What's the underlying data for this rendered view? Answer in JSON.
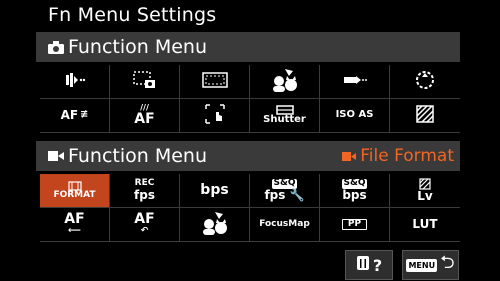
{
  "screen": {
    "title": "Fn Menu Settings"
  },
  "photo_section": {
    "label": "Function Menu",
    "icon": "camera-icon"
  },
  "movie_section": {
    "label": "Function Menu",
    "icon": "movie-icon",
    "current_item_label": "File Format"
  },
  "photo_items": [
    {
      "name": "drive-mode",
      "icon": "drive-mode-icon"
    },
    {
      "name": "focus-area-camera",
      "icon": "focus-area-camera-icon"
    },
    {
      "name": "aspect-frame",
      "icon": "frame-icon"
    },
    {
      "name": "face-eye-af",
      "icon": "face-animal-icon"
    },
    {
      "name": "af-tracking",
      "icon": "af-tracking-icon"
    },
    {
      "name": "dial-focus",
      "icon": "focus-ring-icon"
    },
    {
      "name": "af-sensitivity",
      "text": "AF"
    },
    {
      "name": "af-illuminator",
      "text": "AF"
    },
    {
      "name": "touch-focus",
      "icon": "touch-focus-icon"
    },
    {
      "name": "shutter-type",
      "text": "Shutter"
    },
    {
      "name": "iso-auto",
      "text": "ISO AS"
    },
    {
      "name": "zebra",
      "icon": "zebra-icon"
    }
  ],
  "movie_items": [
    {
      "name": "file-format",
      "text": "FORMAT",
      "selected": true
    },
    {
      "name": "rec-frame-rate",
      "line1": "REC",
      "line2": "fps"
    },
    {
      "name": "bitrate",
      "text": "bps"
    },
    {
      "name": "sq-frame-rate",
      "line1": "S&Q",
      "line2": "fps"
    },
    {
      "name": "sq-bitrate",
      "line1": "S&Q",
      "line2": "bps"
    },
    {
      "name": "lv-display",
      "line1": "",
      "line2": "Lv"
    },
    {
      "name": "af-transition",
      "text": "AF"
    },
    {
      "name": "af-subject-shift",
      "text": "AF"
    },
    {
      "name": "face-detection",
      "icon": "face-animal-icon"
    },
    {
      "name": "focus-map",
      "text": "FocusMap"
    },
    {
      "name": "picture-profile",
      "text": "PP"
    },
    {
      "name": "lut",
      "text": "LUT"
    }
  ],
  "buttons": {
    "delete": {
      "icon": "trash-icon",
      "label": "?"
    },
    "menu": {
      "chip": "MENU",
      "icon": "return-icon"
    }
  },
  "colors": {
    "accent": "#f26522",
    "selected_bg": "#c2451e",
    "bar_bg": "#3a3a3a"
  }
}
